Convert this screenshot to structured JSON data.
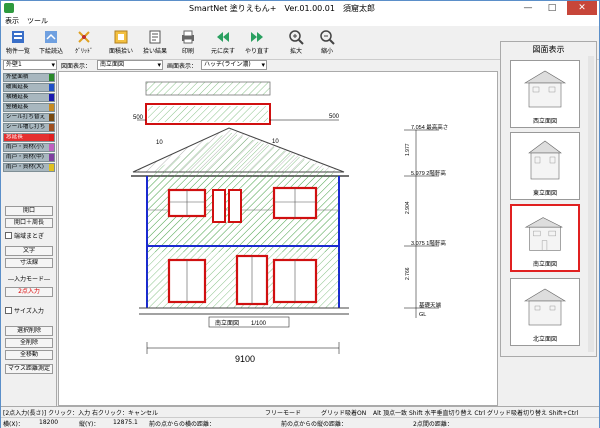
{
  "window": {
    "title": "SmartNet 塗りえもん+　Ver.01.00.01　須窟太郎",
    "minimize": "—",
    "maximize": "□",
    "close": "✕"
  },
  "menu": {
    "view": "表示",
    "tools": "ツール"
  },
  "toolbar": {
    "buttons": [
      {
        "label": "物件一覧",
        "icon": "building-list-icon"
      },
      {
        "label": "下絵読込",
        "icon": "load-drawing-icon"
      },
      {
        "label": "ｸﾞﾘｯﾄﾞ",
        "icon": "grid-icon"
      },
      {
        "label": "面積拾い",
        "icon": "area-pick-icon"
      },
      {
        "label": "拾い結果",
        "icon": "results-icon"
      },
      {
        "label": "印刷",
        "icon": "print-icon"
      },
      {
        "label": "元に戻す",
        "icon": "undo-icon"
      },
      {
        "label": "やり直す",
        "icon": "redo-icon"
      },
      {
        "label": "拡大",
        "icon": "zoom-in-icon"
      },
      {
        "label": "縮小",
        "icon": "zoom-out-icon"
      }
    ]
  },
  "options": {
    "wall_type": "外壁1",
    "drawing_label": "図面表示：",
    "drawing_value": "南立面図",
    "fill_label": "画面表示：",
    "fill_value": "ハッチ(ライン濃)"
  },
  "layers": [
    {
      "label": "外壁面積",
      "color": "#2a8a2a"
    },
    {
      "label": "破風延長",
      "color": "#2050c8"
    },
    {
      "label": "横樋延長",
      "color": "#1a1ab0"
    },
    {
      "label": "竪樋延長",
      "color": "#c88a20"
    },
    {
      "label": "シール打ち替え",
      "color": "#7a4a10"
    },
    {
      "label": "シール増し打ち",
      "color": "#a05020"
    },
    {
      "label": "窓延長",
      "color": "#e02020"
    },
    {
      "label": "雨戸・資材(小)",
      "color": "#c060c0"
    },
    {
      "label": "雨戸・資材(中)",
      "color": "#8040a0"
    },
    {
      "label": "雨戸・資材(大)",
      "color": "#e0c020"
    }
  ],
  "left_buttons": {
    "opening": "開口",
    "opening_perimeter": "開口＋周長",
    "endpoint_check": "端域まとぎ",
    "text": "文字",
    "dimension": "寸法線",
    "input_mode": "―入力モード―",
    "two_point": "2点入力",
    "size_input": "サイズ入力",
    "select_delete": "選択削除",
    "delete_all": "全削除",
    "move_all": "全移動",
    "mouse_distance": "マウス距離測定"
  },
  "drawing": {
    "dim_500_left": "500",
    "dim_500_right": "500",
    "dim_10_left": "10",
    "dim_10_right": "10",
    "eave_height": "7.054 最高高さ",
    "level_2f": "5.979 2階軒高",
    "level_1f": "3.075 1階軒高",
    "gl": "基礎天端",
    "gl2": "GL",
    "v_1977": "1.977",
    "v_2904": "2.904",
    "v_2766": "2.766",
    "plan_caption": "南立面図　　1/100",
    "width_dim": "9100"
  },
  "right_panel": {
    "title": "図面表示",
    "thumbs": [
      {
        "label": "西立面図",
        "selected": false
      },
      {
        "label": "東立面図",
        "selected": false
      },
      {
        "label": "南立面図",
        "selected": true
      },
      {
        "label": "北立面図",
        "selected": false
      }
    ]
  },
  "status": {
    "mode": "[2点入力(長さ)]  クリック：入力  右クリック：キャンセル",
    "free": "フリーモード",
    "grid": "グリッド吸着ON",
    "hints": "Alt 頂点一致  Shift 水平垂直切り替え  Ctrl グリッド吸着切り替え  Shift+Ctrl",
    "x_label": "横(X)：",
    "x_value": "18200",
    "y_label": "縦(Y)：",
    "y_value": "12875.1",
    "prev_x": "前の点からの横の距離：",
    "prev_y": "前の点からの縦の距離：",
    "two_point_dist": "2点間の距離："
  }
}
